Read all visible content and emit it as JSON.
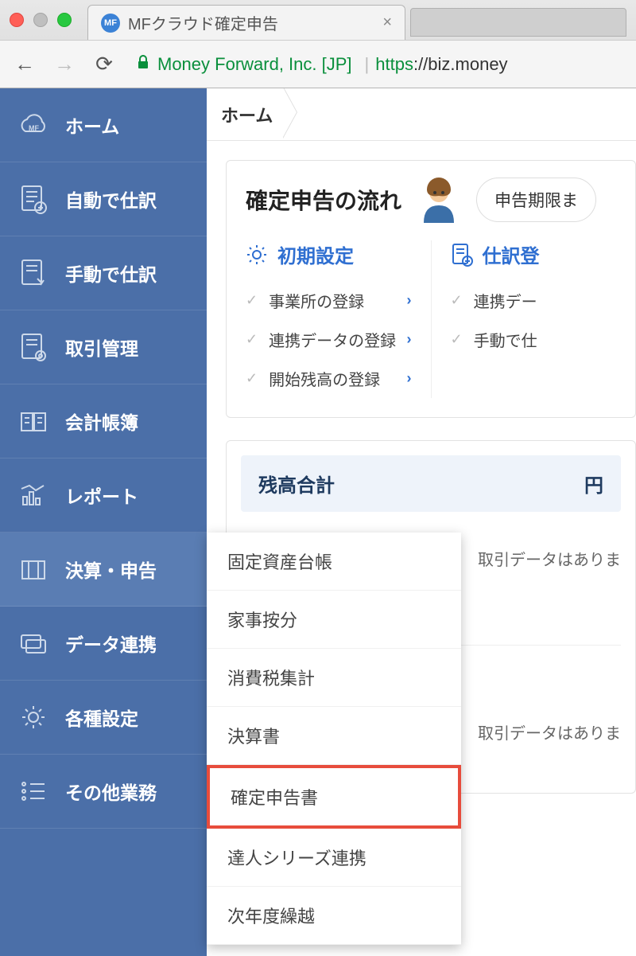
{
  "browser": {
    "tab_title": "MFクラウド確定申告",
    "ev_name": "Money Forward, Inc. [JP]",
    "url_scheme": "https",
    "url_rest": "://biz.money"
  },
  "sidebar": {
    "items": [
      {
        "label": "ホーム",
        "icon": "cloud"
      },
      {
        "label": "自動で仕訳",
        "icon": "doc-plus"
      },
      {
        "label": "手動で仕訳",
        "icon": "doc-hand"
      },
      {
        "label": "取引管理",
        "icon": "doc-gear"
      },
      {
        "label": "会計帳簿",
        "icon": "book"
      },
      {
        "label": "レポート",
        "icon": "chart"
      },
      {
        "label": "決算・申告",
        "icon": "envelope"
      },
      {
        "label": "データ連携",
        "icon": "cards"
      },
      {
        "label": "各種設定",
        "icon": "gear"
      },
      {
        "label": "その他業務",
        "icon": "list"
      }
    ]
  },
  "submenu": {
    "items": [
      "固定資産台帳",
      "家事按分",
      "消費税集計",
      "決算書",
      "確定申告書",
      "達人シリーズ連携",
      "次年度繰越"
    ],
    "highlighted_index": 4
  },
  "breadcrumb": {
    "label": "ホーム"
  },
  "flow": {
    "title": "確定申告の流れ",
    "speech": "申告期限ま",
    "sections": [
      {
        "title": "初期設定",
        "icon": "gear",
        "items": [
          "事業所の登録",
          "連携データの登録",
          "開始残高の登録"
        ]
      },
      {
        "title": "仕訳登",
        "icon": "doc-plus",
        "items": [
          "連携デー",
          "手動で仕"
        ]
      }
    ]
  },
  "balance": {
    "title": "残高合計",
    "unit": "円",
    "no_data_msg": "取引データはありま"
  }
}
